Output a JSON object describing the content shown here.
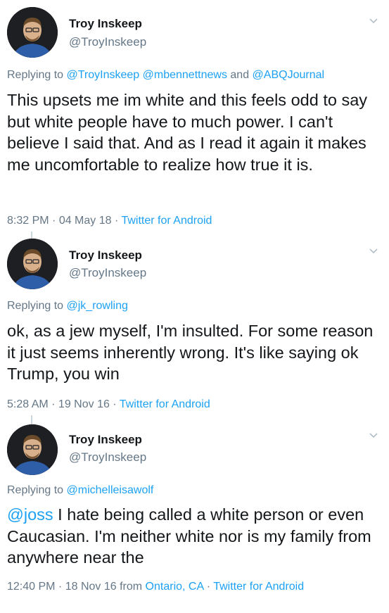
{
  "tweets": [
    {
      "name": "Troy Inskeep",
      "handle": "@TroyInskeep",
      "reply_prefix": "Replying to ",
      "reply_mentions": [
        "@TroyInskeep",
        "@mbennettnews",
        "@ABQJournal"
      ],
      "reply_joiners": [
        " ",
        " and "
      ],
      "body": "This upsets me  im white and this feels odd to say but white people have to much power. I can't believe I said that.  And as I read it again it makes me uncomfortable to realize how true it is.",
      "time": "8:32 PM",
      "date": "04 May 18",
      "client": "Twitter for Android"
    },
    {
      "name": "Troy Inskeep",
      "handle": "@TroyInskeep",
      "reply_prefix": "Replying to ",
      "reply_mentions": [
        "@jk_rowling"
      ],
      "body": "ok, as a jew myself, I'm insulted. For some reason it just seems inherently wrong. It's like saying ok Trump, you win",
      "time": "5:28 AM",
      "date": "19 Nov 16",
      "client": "Twitter for Android"
    },
    {
      "name": "Troy Inskeep",
      "handle": "@TroyInskeep",
      "reply_prefix": "Replying to ",
      "reply_mentions": [
        "@michelleisawolf"
      ],
      "body_mention": "@joss",
      "body": " I hate being called a white person or even Caucasian. I'm neither white nor is my family from anywhere near the",
      "time": "12:40 PM",
      "date": "18 Nov 16",
      "from_label": "from",
      "location": "Ontario, CA",
      "client": "Twitter for Android"
    }
  ],
  "separator": " · ",
  "colors": {
    "link": "#1da1f2",
    "muted": "#657786",
    "text": "#14171a"
  },
  "icons": {
    "avatar": "profile-photo",
    "menu": "chevron-down-icon"
  }
}
